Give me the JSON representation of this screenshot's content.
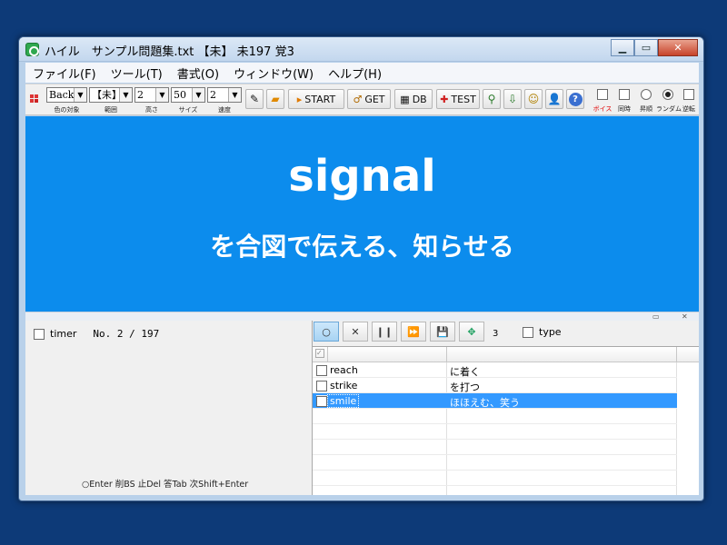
{
  "window": {
    "title": "ハイル　サンプル問題集.txt 【未】 未197 覚3"
  },
  "menu": [
    "ファイル(F)",
    "ツール(T)",
    "書式(O)",
    "ウィンドウ(W)",
    "ヘルプ(H)"
  ],
  "toolbar": {
    "color_target": {
      "value": "Back",
      "caption": "色の対象"
    },
    "range": {
      "value": "【未】",
      "caption": "範囲"
    },
    "height": {
      "value": "2",
      "caption": "高さ"
    },
    "size": {
      "value": "50",
      "caption": "サイズ"
    },
    "speed": {
      "value": "2",
      "caption": "速度"
    },
    "start_label": "START",
    "get_label": "GET",
    "db_label": "DB",
    "test_label": "TEST",
    "options": [
      {
        "caption": "ボイス",
        "kind": "checkbox",
        "checked": false,
        "color": "#e00000"
      },
      {
        "caption": "同時",
        "kind": "checkbox",
        "checked": false
      },
      {
        "caption": "昇順",
        "kind": "radio",
        "checked": false
      },
      {
        "caption": "ランダム",
        "kind": "radio",
        "checked": true
      },
      {
        "caption": "逆転",
        "kind": "checkbox",
        "checked": false
      }
    ]
  },
  "card": {
    "word": "signal",
    "meaning": "を合図で伝える、知らせる",
    "background": "#0c8ced"
  },
  "left": {
    "timer_label": "timer",
    "progress_text": "No. 2 / 197",
    "hint": "○Enter 削BS 止Del 答Tab 次Shift+Enter"
  },
  "right": {
    "count": "3",
    "type_label": "type",
    "rows": [
      {
        "word": "reach",
        "meaning": "に着く",
        "checked": false,
        "selected": false
      },
      {
        "word": "strike",
        "meaning": "を打つ",
        "checked": false,
        "selected": false
      },
      {
        "word": "smile",
        "meaning": "ほほえむ、笑う",
        "checked": false,
        "selected": true
      }
    ]
  },
  "colors": {
    "desktop": "#0d3a78",
    "selection": "#3399ff"
  }
}
